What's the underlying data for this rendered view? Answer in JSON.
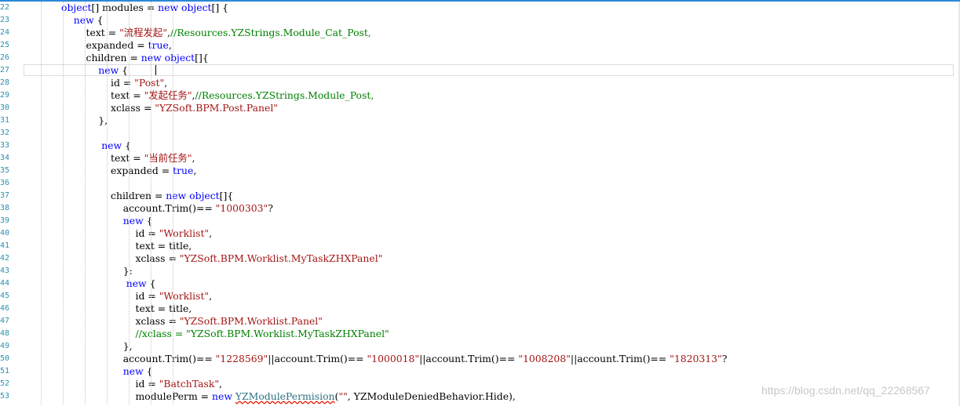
{
  "editor": {
    "lines": [
      {
        "num": "22",
        "segs": [
          {
            "t": "object",
            "c": "kw"
          },
          {
            "t": "[] modules = "
          },
          {
            "t": "new",
            "c": "kw"
          },
          {
            "t": " "
          },
          {
            "t": "object",
            "c": "kw"
          },
          {
            "t": "[] {"
          }
        ]
      },
      {
        "num": "23",
        "segs": [
          {
            "t": "    "
          },
          {
            "t": "new",
            "c": "kw"
          },
          {
            "t": " {"
          }
        ]
      },
      {
        "num": "24",
        "segs": [
          {
            "t": "        text = "
          },
          {
            "t": "\"流程发起\"",
            "c": "str"
          },
          {
            "t": ","
          },
          {
            "t": "//Resources.YZStrings.Module_Cat_Post,",
            "c": "cmt"
          }
        ]
      },
      {
        "num": "25",
        "segs": [
          {
            "t": "        expanded = "
          },
          {
            "t": "true",
            "c": "kw"
          },
          {
            "t": ","
          }
        ]
      },
      {
        "num": "26",
        "segs": [
          {
            "t": "        children = "
          },
          {
            "t": "new",
            "c": "kw"
          },
          {
            "t": " "
          },
          {
            "t": "object",
            "c": "kw"
          },
          {
            "t": "[]{"
          }
        ]
      },
      {
        "num": "27",
        "segs": [
          {
            "t": "            "
          },
          {
            "t": "new",
            "c": "kw"
          },
          {
            "t": " {"
          }
        ]
      },
      {
        "num": "28",
        "segs": [
          {
            "t": "                id = "
          },
          {
            "t": "\"Post\"",
            "c": "str"
          },
          {
            "t": ","
          }
        ]
      },
      {
        "num": "29",
        "segs": [
          {
            "t": "                text = "
          },
          {
            "t": "\"发起任务\"",
            "c": "str"
          },
          {
            "t": ","
          },
          {
            "t": "//Resources.YZStrings.Module_Post,",
            "c": "cmt"
          }
        ]
      },
      {
        "num": "30",
        "segs": [
          {
            "t": "                xclass = "
          },
          {
            "t": "\"YZSoft.BPM.Post.Panel\"",
            "c": "str"
          }
        ]
      },
      {
        "num": "31",
        "segs": [
          {
            "t": "            },"
          }
        ]
      },
      {
        "num": "32",
        "segs": []
      },
      {
        "num": "33",
        "segs": [
          {
            "t": "             "
          },
          {
            "t": "new",
            "c": "kw"
          },
          {
            "t": " {"
          }
        ]
      },
      {
        "num": "34",
        "segs": [
          {
            "t": "                text = "
          },
          {
            "t": "\"当前任务\"",
            "c": "str"
          },
          {
            "t": ","
          }
        ]
      },
      {
        "num": "35",
        "segs": [
          {
            "t": "                expanded = "
          },
          {
            "t": "true",
            "c": "kw"
          },
          {
            "t": ","
          }
        ]
      },
      {
        "num": "36",
        "segs": []
      },
      {
        "num": "37",
        "segs": [
          {
            "t": "                children = "
          },
          {
            "t": "new",
            "c": "kw"
          },
          {
            "t": " "
          },
          {
            "t": "object",
            "c": "kw"
          },
          {
            "t": "[]{"
          }
        ]
      },
      {
        "num": "38",
        "segs": [
          {
            "t": "                    account.Trim()== "
          },
          {
            "t": "\"1000303\"",
            "c": "str"
          },
          {
            "t": "?"
          }
        ]
      },
      {
        "num": "39",
        "segs": [
          {
            "t": "                    "
          },
          {
            "t": "new",
            "c": "kw"
          },
          {
            "t": " {"
          }
        ]
      },
      {
        "num": "40",
        "segs": [
          {
            "t": "                        id = "
          },
          {
            "t": "\"Worklist\"",
            "c": "str"
          },
          {
            "t": ","
          }
        ]
      },
      {
        "num": "41",
        "segs": [
          {
            "t": "                        text = title,"
          }
        ]
      },
      {
        "num": "42",
        "segs": [
          {
            "t": "                        xclass = "
          },
          {
            "t": "\"YZSoft.BPM.Worklist.MyTaskZHXPanel\"",
            "c": "str"
          }
        ]
      },
      {
        "num": "43",
        "segs": [
          {
            "t": "                    }:"
          }
        ]
      },
      {
        "num": "44",
        "segs": [
          {
            "t": "                     "
          },
          {
            "t": "new",
            "c": "kw"
          },
          {
            "t": " {"
          }
        ]
      },
      {
        "num": "45",
        "segs": [
          {
            "t": "                        id = "
          },
          {
            "t": "\"Worklist\"",
            "c": "str"
          },
          {
            "t": ","
          }
        ]
      },
      {
        "num": "46",
        "segs": [
          {
            "t": "                        text = title,"
          }
        ]
      },
      {
        "num": "47",
        "segs": [
          {
            "t": "                        xclass = "
          },
          {
            "t": "\"YZSoft.BPM.Worklist.Panel\"",
            "c": "str"
          }
        ]
      },
      {
        "num": "48",
        "segs": [
          {
            "t": "                        "
          },
          {
            "t": "//xclass = \"YZSoft.BPM.Worklist.MyTaskZHXPanel\"",
            "c": "cmt"
          }
        ]
      },
      {
        "num": "49",
        "segs": [
          {
            "t": "                    },"
          }
        ]
      },
      {
        "num": "50",
        "segs": [
          {
            "t": "                    account.Trim()== "
          },
          {
            "t": "\"1228569\"",
            "c": "str"
          },
          {
            "t": "||account.Trim()== "
          },
          {
            "t": "\"1000018\"",
            "c": "str"
          },
          {
            "t": "||account.Trim()== "
          },
          {
            "t": "\"1008208\"",
            "c": "str"
          },
          {
            "t": "||account.Trim()== "
          },
          {
            "t": "\"1820313\"",
            "c": "str"
          },
          {
            "t": "?"
          }
        ]
      },
      {
        "num": "51",
        "segs": [
          {
            "t": "                    "
          },
          {
            "t": "new",
            "c": "kw"
          },
          {
            "t": " {"
          }
        ]
      },
      {
        "num": "52",
        "segs": [
          {
            "t": "                        id = "
          },
          {
            "t": "\"BatchTask\"",
            "c": "str"
          },
          {
            "t": ","
          }
        ]
      },
      {
        "num": "53",
        "segs": [
          {
            "t": "                        modulePerm = "
          },
          {
            "t": "new",
            "c": "kw"
          },
          {
            "t": " "
          },
          {
            "t": "YZModulePermision",
            "c": "sq"
          },
          {
            "t": "("
          },
          {
            "t": "\"\"",
            "c": "str"
          },
          {
            "t": ", YZModuleDeniedBehavior.Hide),"
          }
        ]
      }
    ]
  },
  "watermark": "https://blog.csdn.net/qq_22268567"
}
